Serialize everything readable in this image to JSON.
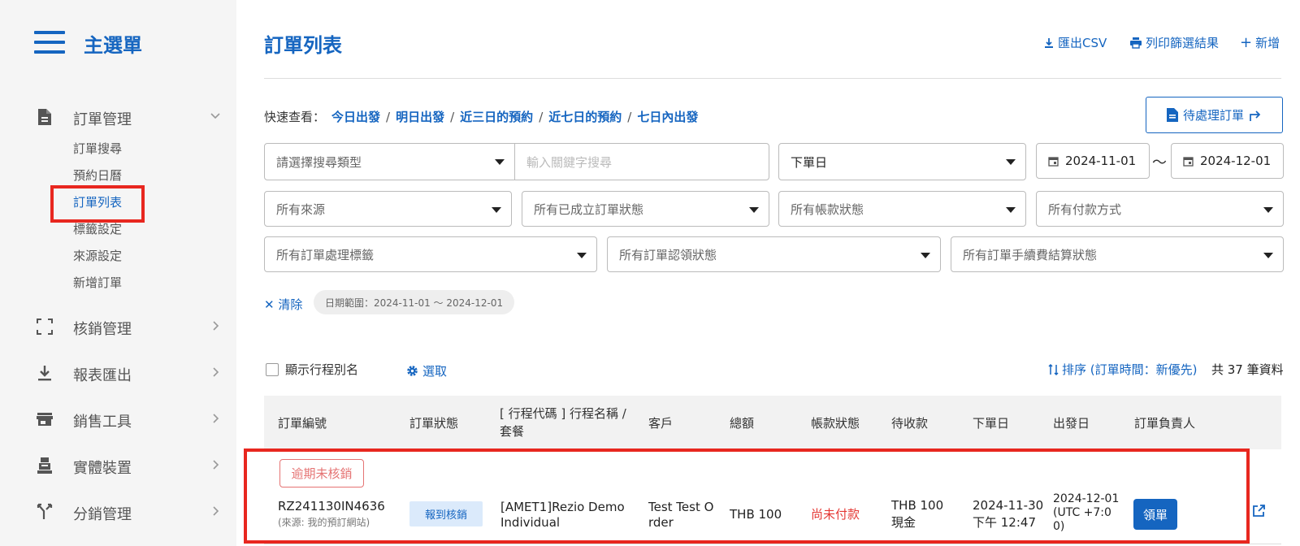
{
  "sidebar": {
    "title": "主選單",
    "groups": [
      {
        "label": "訂單管理",
        "icon": "document-icon"
      },
      {
        "label": "核銷管理",
        "icon": "scan-frame-icon"
      },
      {
        "label": "報表匯出",
        "icon": "download-icon"
      },
      {
        "label": "銷售工具",
        "icon": "store-icon"
      },
      {
        "label": "實體裝置",
        "icon": "device-icon"
      },
      {
        "label": "分銷管理",
        "icon": "split-icon"
      }
    ],
    "subitems": [
      "訂單搜尋",
      "預約日曆",
      "訂單列表",
      "標籤設定",
      "來源設定",
      "新增訂單"
    ],
    "active_subitem": "訂單列表"
  },
  "header": {
    "title": "訂單列表",
    "export_csv": "匯出CSV",
    "print_filtered": "列印篩選結果",
    "add_new": "新增"
  },
  "quick_view": {
    "label": "快速查看：",
    "links": [
      "今日出發",
      "明日出發",
      "近三日的預約",
      "近七日的預約",
      "七日內出發"
    ]
  },
  "pending_orders_button": "待處理訂單",
  "filters": {
    "search_type_placeholder": "請選擇搜尋類型",
    "keyword_placeholder": "輸入關鍵字搜尋",
    "date_type": "下單日",
    "date_from": "2024-11-01",
    "date_to": "2024-12-01",
    "date_separator": "〜",
    "source": "所有來源",
    "order_status": "所有已成立訂單狀態",
    "account_status": "所有帳款狀態",
    "payment_method": "所有付款方式",
    "processing_tag": "所有訂單處理標籤",
    "claim_status": "所有訂單認領狀態",
    "fee_settlement": "所有訂單手續費結算狀態"
  },
  "active_filters": {
    "clear_label": "清除",
    "chip": "日期範圍：2024-11-01 〜 2024-12-01"
  },
  "list_controls": {
    "show_alias_label": "顯示行程別名",
    "select_label": "選取",
    "sort_label": "排序 (訂單時間：新優先)",
    "total": "共 37 筆資料"
  },
  "table": {
    "headers": [
      "訂單編號",
      "訂單狀態",
      "[ 行程代碼 ] 行程名稱 /",
      "套餐",
      "客戶",
      "總額",
      "帳款狀態",
      "待收款",
      "下單日",
      "出發日",
      "訂單負責人"
    ],
    "rows": [
      {
        "alert_badge": "逾期未核銷",
        "order_no": "RZ241130IN4636",
        "order_source": "(來源: 我的預訂網站)",
        "status": "報到核銷",
        "product_line1": "[AMET1]Rezio Demo",
        "product_line2": "Individual",
        "customer_line1": "Test Test O",
        "customer_line2": "rder",
        "total": "THB 100",
        "account_status": "尚未付款",
        "receivable_line1": "THB 100",
        "receivable_line2": "現金",
        "order_date_line1": "2024-11-30",
        "order_date_line2": "下午 12:47",
        "depart_line1": "2024-12-01",
        "depart_line2": "(UTC +7:0",
        "depart_line3": "0)",
        "claim_button": "領單"
      }
    ]
  },
  "colors": {
    "accent": "#1565c0",
    "highlight_box": "#e8271f",
    "unpaid": "#e53935",
    "overdue": "#e57373"
  }
}
